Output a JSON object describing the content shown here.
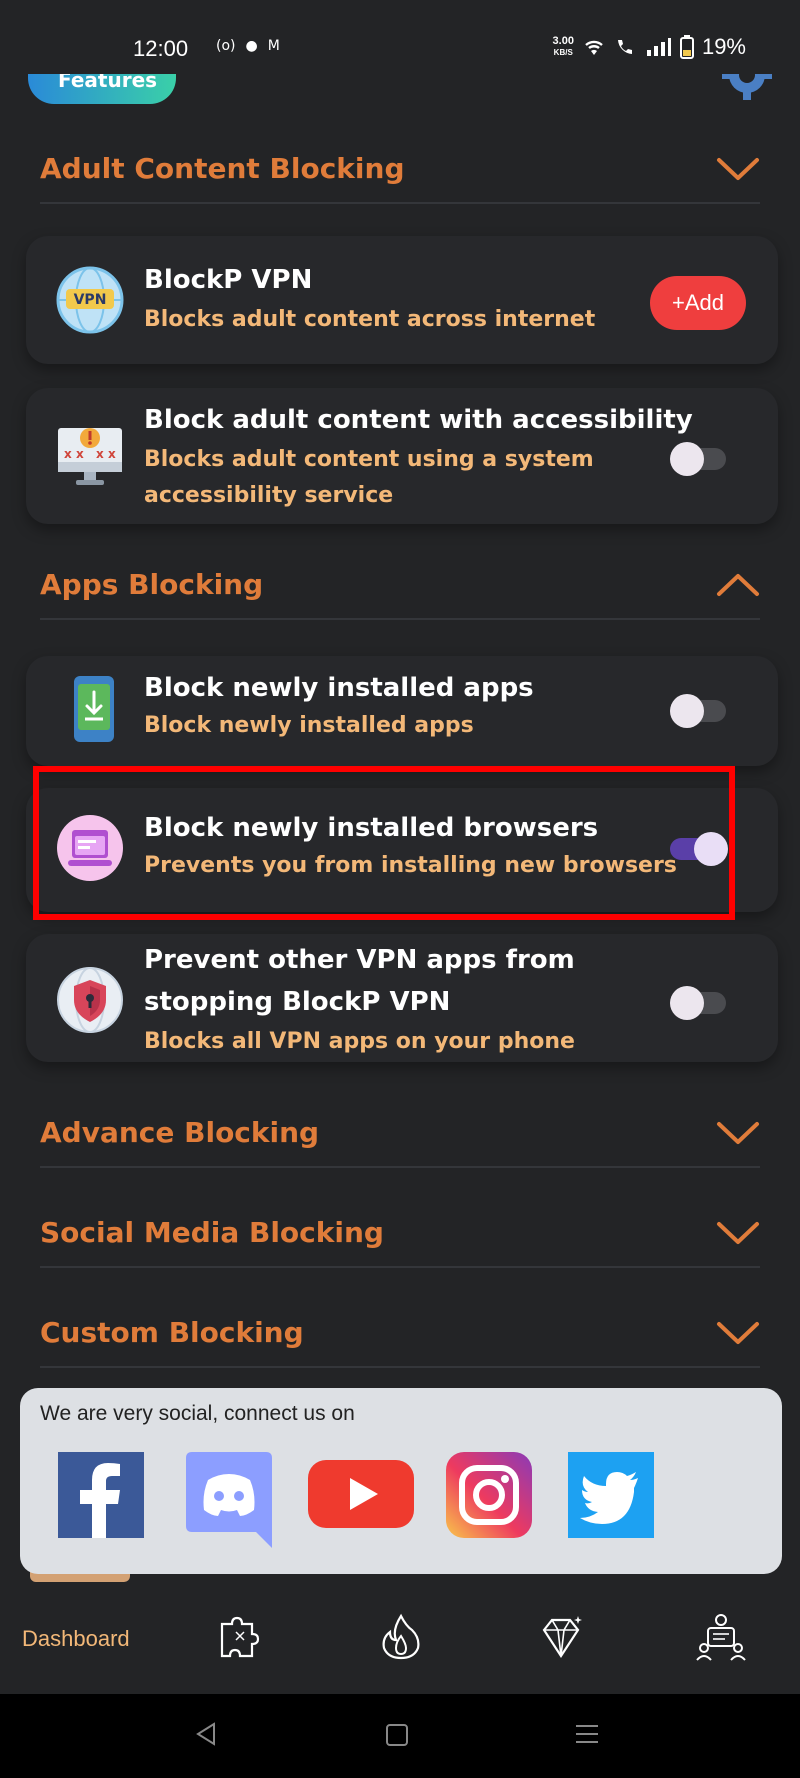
{
  "status_bar": {
    "time": "12:00",
    "net_speed_value": "3.00",
    "net_speed_unit": "KB/S",
    "battery": "19%"
  },
  "top": {
    "features_label": "Features"
  },
  "sections": {
    "adult": {
      "title": "Adult Content Blocking",
      "state": "collapsed"
    },
    "apps": {
      "title": "Apps Blocking",
      "state": "expanded"
    },
    "advance": {
      "title": "Advance Blocking",
      "state": "collapsed"
    },
    "social": {
      "title": "Social Media Blocking",
      "state": "collapsed"
    },
    "custom": {
      "title": "Custom Blocking",
      "state": "collapsed"
    }
  },
  "cards": {
    "vpn": {
      "title": "BlockP VPN",
      "subtitle": "Blocks adult content across internet",
      "button": "+Add",
      "icon": "vpn-globe-icon",
      "icon_text": "VPN"
    },
    "accessibility": {
      "title": "Block adult content with accessibility",
      "subtitle_line1": "Blocks adult content using a system",
      "subtitle_line2": "accessibility service",
      "toggle_on": false,
      "icon": "monitor-warning-icon"
    },
    "new_apps": {
      "title": "Block newly installed apps",
      "subtitle": "Block newly installed apps",
      "toggle_on": false,
      "icon": "phone-download-icon"
    },
    "new_browsers": {
      "title": "Block newly installed browsers",
      "subtitle": "Prevents you from installing new browsers",
      "toggle_on": true,
      "icon": "browser-window-icon"
    },
    "prevent_vpn": {
      "title_line1": "Prevent other VPN apps from",
      "title_line2": "stopping BlockP VPN",
      "subtitle": "Blocks all VPN apps on your phone",
      "toggle_on": false,
      "icon": "shield-lock-icon"
    }
  },
  "social": {
    "title": "We are very social, connect us on",
    "networks": [
      "facebook",
      "discord",
      "youtube",
      "instagram",
      "twitter"
    ],
    "colors": {
      "facebook": "#3b5998",
      "discord": "#8c9eff",
      "youtube": "#ef3a2e",
      "twitter": "#1da1f2"
    }
  },
  "bottom_nav": {
    "dashboard_label": "Dashboard",
    "icons": [
      "puzzle-icon",
      "flame-icon",
      "diamond-icon",
      "user-group-icon"
    ]
  },
  "colors": {
    "background": "#232426",
    "accent_orange": "#e07c3a",
    "subtitle_orange": "#f3b878",
    "add_red": "#ef3e3e",
    "toggle_on": "#5a3fa8",
    "highlight_red": "#ff0000"
  }
}
